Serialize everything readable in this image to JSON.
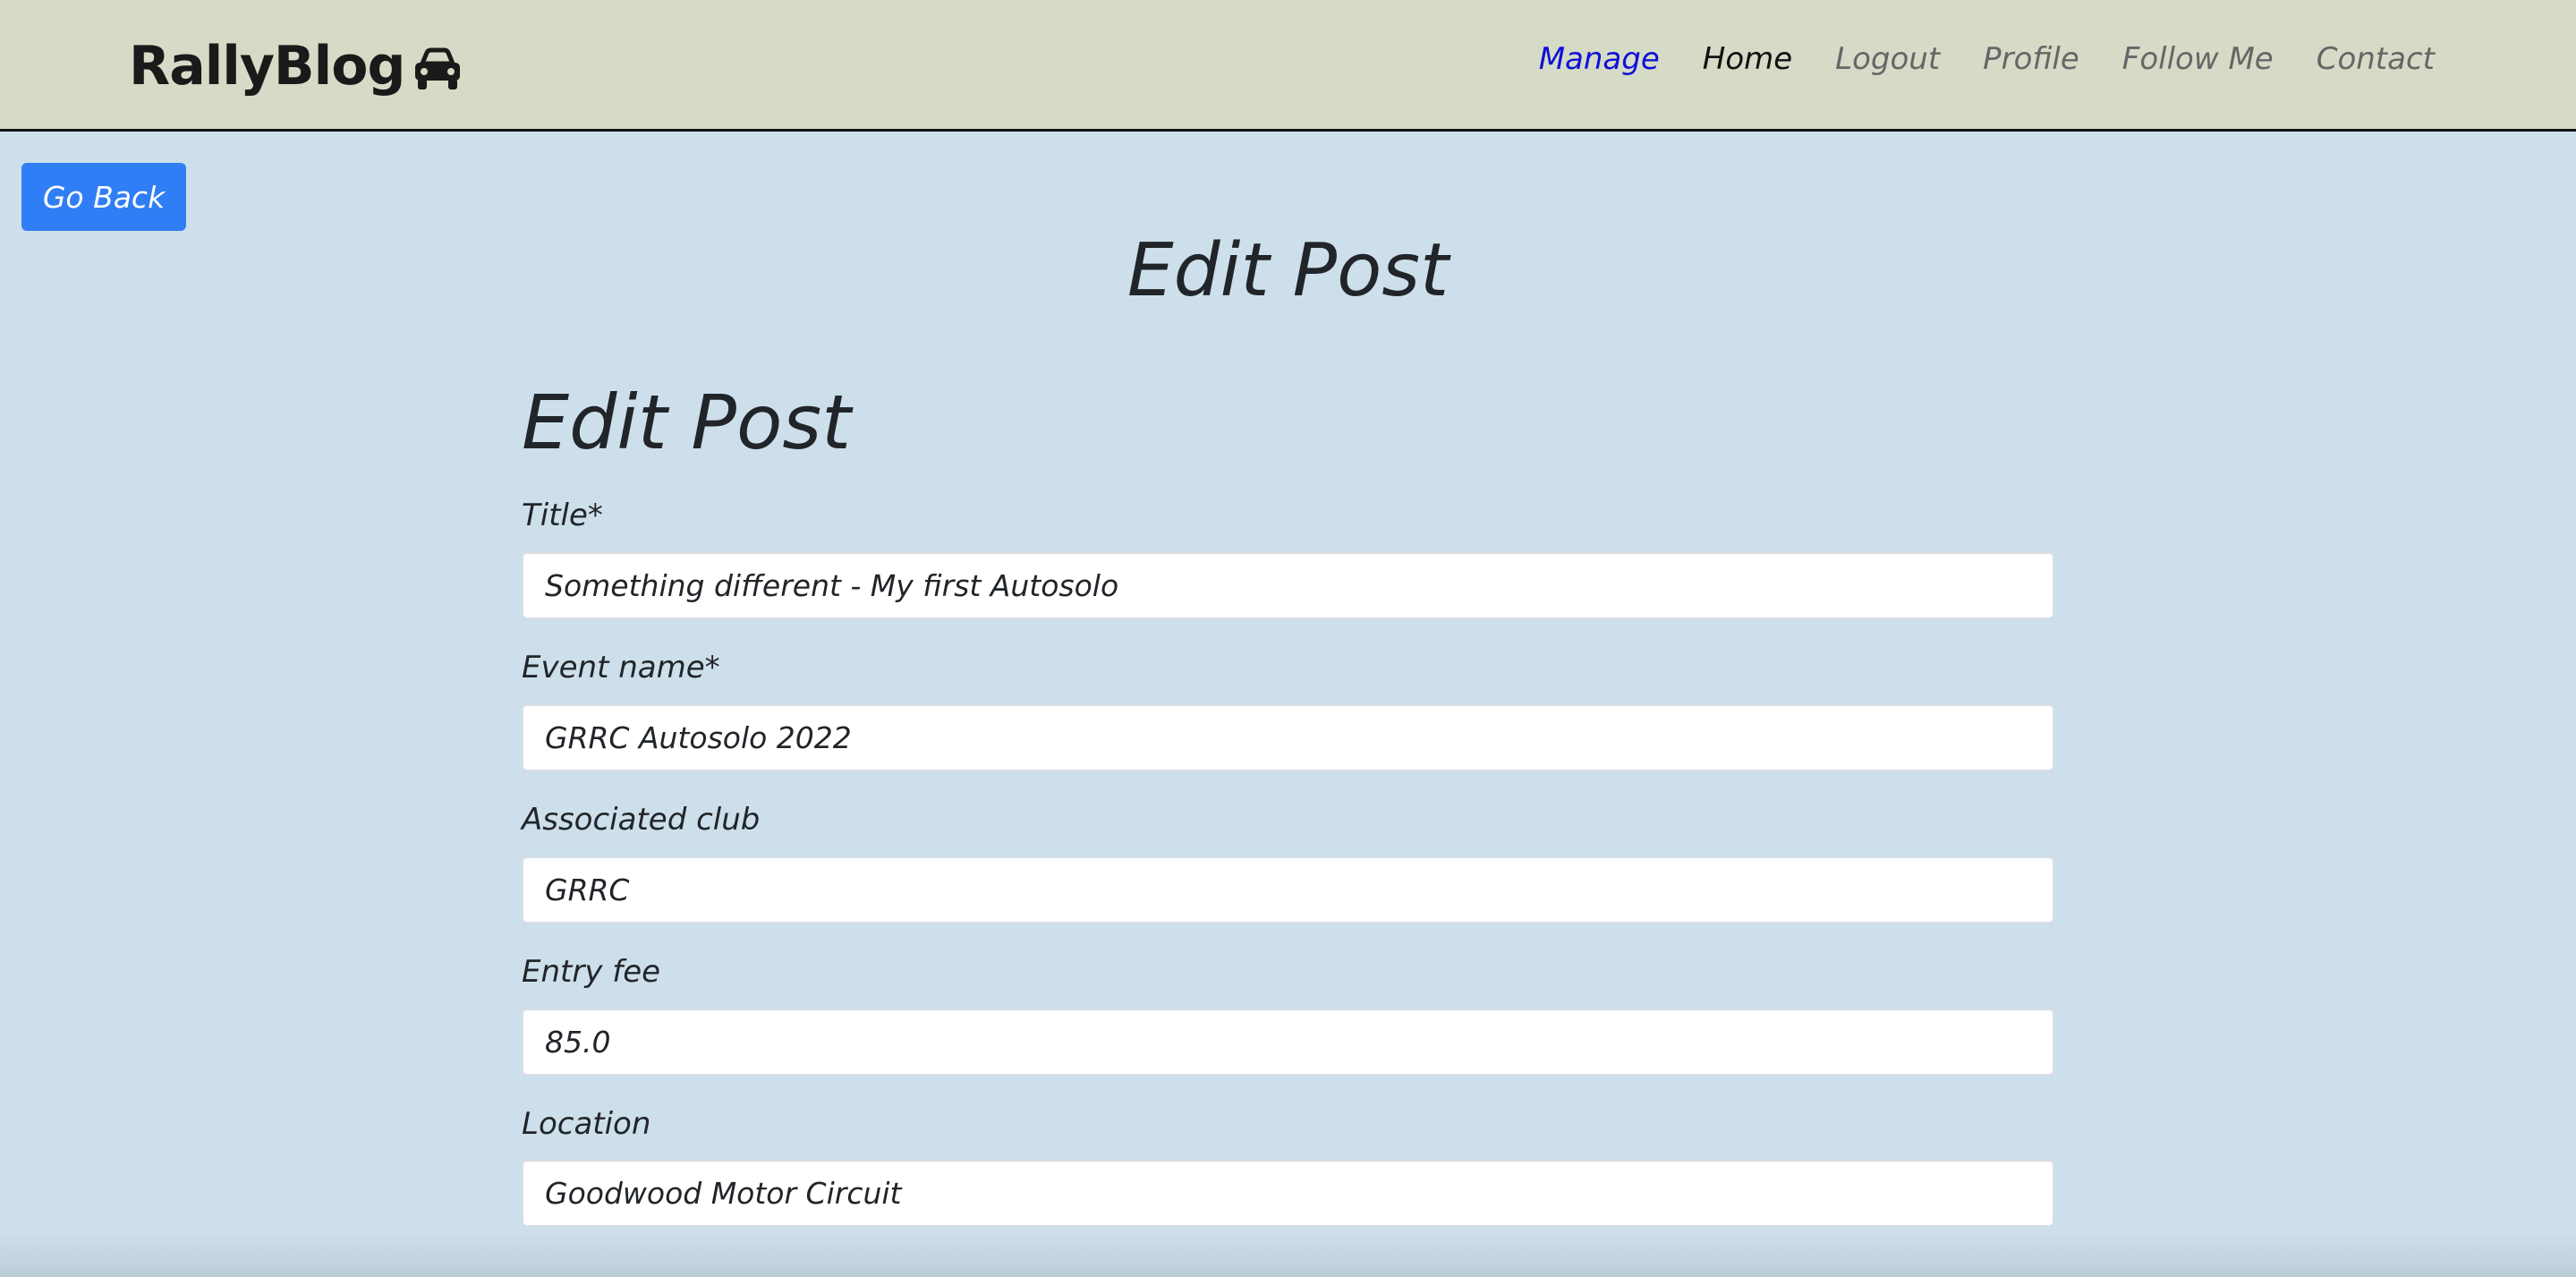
{
  "nav": {
    "brand": "RallyBlog",
    "brand_icon": "car-icon",
    "links": [
      "Manage",
      "Home",
      "Logout",
      "Profile",
      "Follow Me",
      "Contact"
    ],
    "active_color": "#1010d8"
  },
  "go_back_label": "Go Back",
  "page_title": "Edit Post",
  "form": {
    "title": "Edit Post",
    "fields": [
      {
        "label": "Title*",
        "value": "Something different - My first Autosolo"
      },
      {
        "label": "Event name*",
        "value": "GRRC Autosolo 2022"
      },
      {
        "label": "Associated club",
        "value": "GRRC"
      },
      {
        "label": "Entry fee",
        "value": "85.0"
      },
      {
        "label": "Location",
        "value": "Goodwood Motor Circuit"
      }
    ]
  },
  "colors": {
    "navbar_bg": "#d5dbc7",
    "page_bg": "#cddfeb",
    "button_bg": "#2f7ef5"
  }
}
